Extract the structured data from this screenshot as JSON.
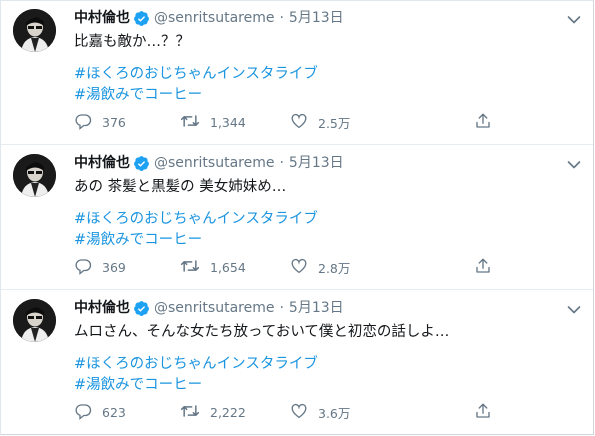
{
  "tweets": [
    {
      "name": "中村倫也",
      "handle": "@senritsutareme",
      "separator": "·",
      "date": "5月13日",
      "text": "比嘉も敵か…？？",
      "hashtags": [
        "#ほくろのおじちゃんインスタライブ",
        "#湯飲みでコーヒー"
      ],
      "replies": "376",
      "retweets": "1,344",
      "likes": "2.5万"
    },
    {
      "name": "中村倫也",
      "handle": "@senritsutareme",
      "separator": "·",
      "date": "5月13日",
      "text": "あの 茶髪と黒髪の 美女姉妹め…",
      "hashtags": [
        "#ほくろのおじちゃんインスタライブ",
        "#湯飲みでコーヒー"
      ],
      "replies": "369",
      "retweets": "1,654",
      "likes": "2.8万"
    },
    {
      "name": "中村倫也",
      "handle": "@senritsutareme",
      "separator": "·",
      "date": "5月13日",
      "text": "ムロさん、そんな女たち放っておいて僕と初恋の話しよ…",
      "hashtags": [
        "#ほくろのおじちゃんインスタライブ",
        "#湯飲みでコーヒー"
      ],
      "replies": "623",
      "retweets": "2,222",
      "likes": "3.6万"
    }
  ],
  "colors": {
    "text": "#14171a",
    "muted": "#657786",
    "link": "#1b95e0",
    "verified": "#1da1f2",
    "border": "#e6ecf0"
  },
  "icons": {
    "verified": "verified-badge-icon",
    "caret": "chevron-down-icon",
    "reply": "reply-icon",
    "retweet": "retweet-icon",
    "like": "heart-icon",
    "share": "share-icon"
  }
}
